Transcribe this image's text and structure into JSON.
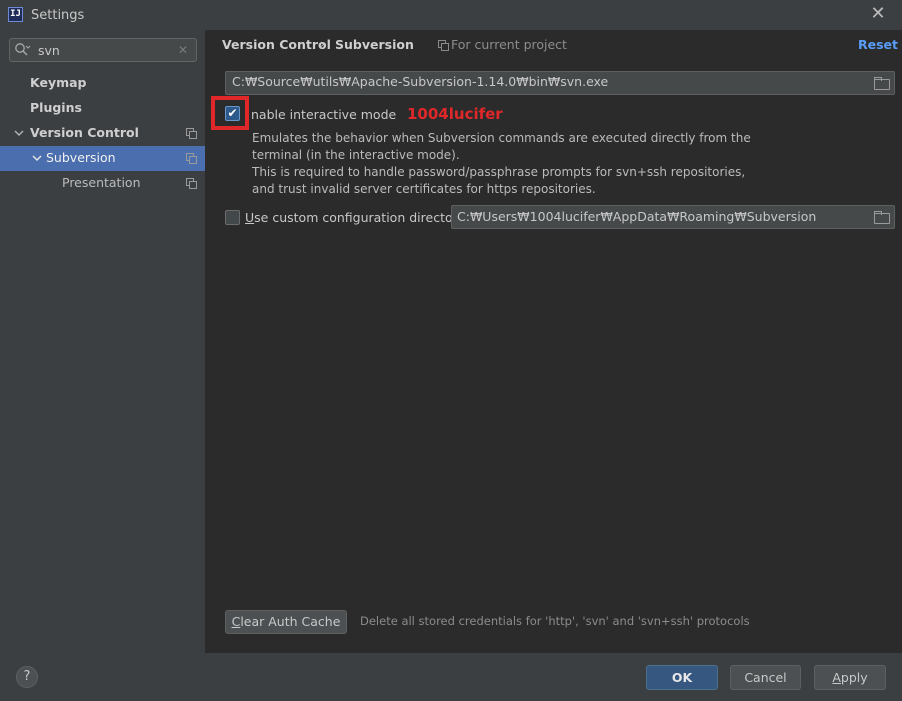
{
  "window": {
    "title": "Settings",
    "app_icon_text": "IJ"
  },
  "search": {
    "value": "svn"
  },
  "sidebar": {
    "items": [
      {
        "label": "Keymap"
      },
      {
        "label": "Plugins"
      },
      {
        "label": "Version Control"
      },
      {
        "label": "Subversion"
      },
      {
        "label": "Presentation"
      }
    ]
  },
  "header": {
    "breadcrumb_parent": "Version Control",
    "breadcrumb_separator": "›",
    "breadcrumb_current": "Subversion",
    "scope_label": "For current project",
    "reset_label": "Reset"
  },
  "svn_path": {
    "value": "C:₩Source₩utils₩Apache-Subversion-1.14.0₩bin₩svn.exe"
  },
  "interactive_mode": {
    "checked": true,
    "label": "nable interactive mode",
    "watermark": "1004lucifer",
    "description_lines": [
      "Emulates the behavior when Subversion commands are executed directly from the",
      "terminal (in the interactive mode).",
      "This is required to handle password/passphrase prompts for svn+ssh repositories,",
      "and trust invalid server certificates for https repositories."
    ]
  },
  "custom_config": {
    "checked": false,
    "label_mnemonic": "U",
    "label_rest": "se custom configuration directory:",
    "value": "C:₩Users₩1004lucifer₩AppData₩Roaming₩Subversion"
  },
  "clear_auth": {
    "button_mnemonic": "C",
    "button_rest": "lear Auth Cache",
    "description": "Delete all stored credentials for 'http', 'svn' and 'svn+ssh' protocols"
  },
  "footer": {
    "help_label": "?",
    "ok_label": "OK",
    "cancel_label": "Cancel",
    "apply_mnemonic": "A",
    "apply_rest": "pply"
  },
  "colors": {
    "accent": "#4b6eaf",
    "link": "#589df6",
    "highlight": "#e0282a"
  }
}
